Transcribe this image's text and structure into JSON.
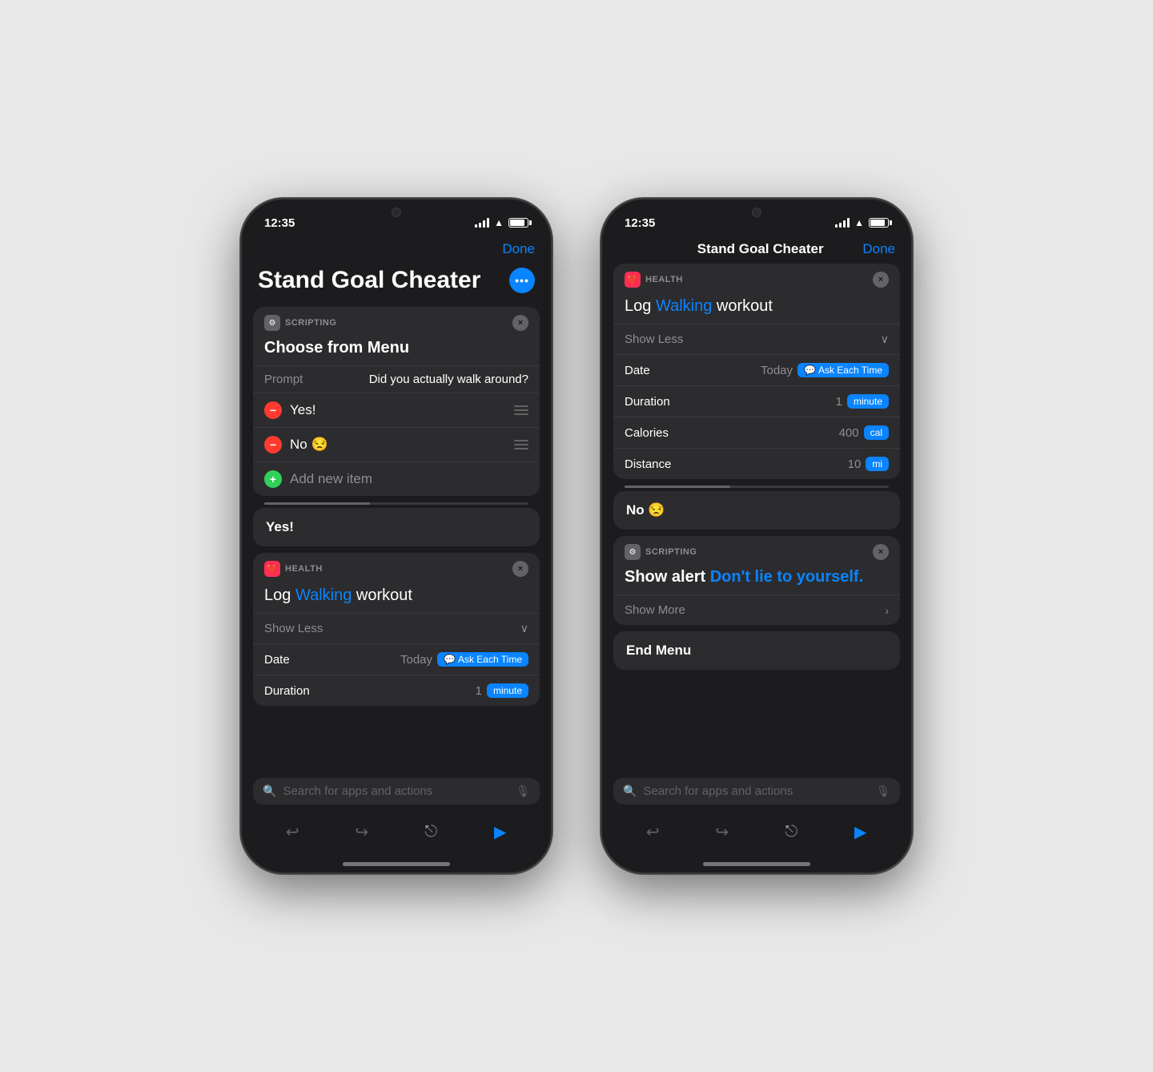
{
  "phone1": {
    "status": {
      "time": "12:35",
      "signal": true,
      "wifi": true,
      "battery": true
    },
    "nav": {
      "done_label": "Done"
    },
    "title": "Stand Goal Cheater",
    "more_btn_label": "•••",
    "scripting_card": {
      "category": "SCRIPTING",
      "title": "Choose from Menu",
      "close_icon": "×",
      "prompt_label": "Prompt",
      "prompt_value": "Did you actually walk around?",
      "items": [
        {
          "label": "Yes!",
          "type": "minus"
        },
        {
          "label": "No 😒",
          "type": "minus"
        }
      ],
      "add_label": "Add new item"
    },
    "yes_section": {
      "label": "Yes!"
    },
    "health_card": {
      "category": "HEALTH",
      "close_icon": "×",
      "log_prefix": "Log",
      "log_activity": "Walking",
      "log_suffix": "workout",
      "show_less_label": "Show Less",
      "date_label": "Date",
      "date_value": "Today",
      "ask_label": "Ask Each Time",
      "duration_label": "Duration",
      "duration_value": "1",
      "duration_unit": "minute"
    },
    "search": {
      "placeholder": "Search for apps and actions"
    },
    "toolbar": {
      "undo": "↩",
      "redo": "↪",
      "share": "⬆",
      "play": "▶"
    }
  },
  "phone2": {
    "status": {
      "time": "12:35"
    },
    "nav": {
      "title": "Stand Goal Cheater",
      "done_label": "Done"
    },
    "health_card": {
      "category": "HEALTH",
      "close_icon": "×",
      "log_prefix": "Log",
      "log_activity": "Walking",
      "log_suffix": "workout",
      "show_less_label": "Show Less",
      "date_label": "Date",
      "date_value": "Today",
      "ask_label": "Ask Each Time",
      "duration_label": "Duration",
      "duration_value": "1",
      "duration_unit": "minute",
      "calories_label": "Calories",
      "calories_value": "400",
      "calories_unit": "cal",
      "distance_label": "Distance",
      "distance_value": "10",
      "distance_unit": "mi"
    },
    "no_section": {
      "label": "No 😒"
    },
    "scripting_alert_card": {
      "category": "SCRIPTING",
      "close_icon": "×",
      "title_prefix": "Show alert",
      "title_blue": "Don't lie to yourself.",
      "show_more_label": "Show More"
    },
    "end_menu": {
      "label": "End Menu"
    },
    "search": {
      "placeholder": "Search for apps and actions"
    },
    "toolbar": {
      "undo": "↩",
      "redo": "↪",
      "share": "⬆",
      "play": "▶"
    }
  }
}
